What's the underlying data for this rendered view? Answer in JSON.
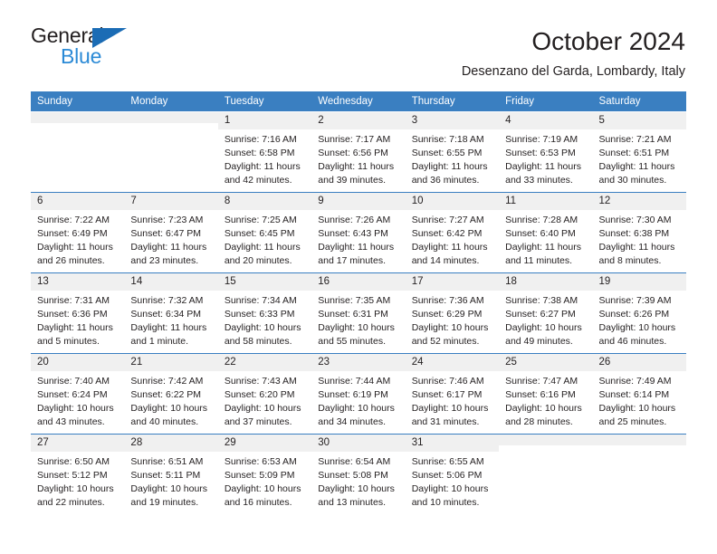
{
  "brand": {
    "name_part1": "General",
    "name_part2": "Blue",
    "accent_dark": "#1b6cb5",
    "accent_light": "#2b8ad6"
  },
  "header": {
    "title": "October 2024",
    "subtitle": "Desenzano del Garda, Lombardy, Italy"
  },
  "theme": {
    "header_blue": "#3a7fc1",
    "daynum_gray": "#f0f0f0",
    "text": "#231f20"
  },
  "weekday_headers": [
    "Sunday",
    "Monday",
    "Tuesday",
    "Wednesday",
    "Thursday",
    "Friday",
    "Saturday"
  ],
  "weeks": [
    [
      {
        "day": "",
        "sunrise": "",
        "sunset": "",
        "daylight": ""
      },
      {
        "day": "",
        "sunrise": "",
        "sunset": "",
        "daylight": ""
      },
      {
        "day": "1",
        "sunrise": "Sunrise: 7:16 AM",
        "sunset": "Sunset: 6:58 PM",
        "daylight": "Daylight: 11 hours and 42 minutes."
      },
      {
        "day": "2",
        "sunrise": "Sunrise: 7:17 AM",
        "sunset": "Sunset: 6:56 PM",
        "daylight": "Daylight: 11 hours and 39 minutes."
      },
      {
        "day": "3",
        "sunrise": "Sunrise: 7:18 AM",
        "sunset": "Sunset: 6:55 PM",
        "daylight": "Daylight: 11 hours and 36 minutes."
      },
      {
        "day": "4",
        "sunrise": "Sunrise: 7:19 AM",
        "sunset": "Sunset: 6:53 PM",
        "daylight": "Daylight: 11 hours and 33 minutes."
      },
      {
        "day": "5",
        "sunrise": "Sunrise: 7:21 AM",
        "sunset": "Sunset: 6:51 PM",
        "daylight": "Daylight: 11 hours and 30 minutes."
      }
    ],
    [
      {
        "day": "6",
        "sunrise": "Sunrise: 7:22 AM",
        "sunset": "Sunset: 6:49 PM",
        "daylight": "Daylight: 11 hours and 26 minutes."
      },
      {
        "day": "7",
        "sunrise": "Sunrise: 7:23 AM",
        "sunset": "Sunset: 6:47 PM",
        "daylight": "Daylight: 11 hours and 23 minutes."
      },
      {
        "day": "8",
        "sunrise": "Sunrise: 7:25 AM",
        "sunset": "Sunset: 6:45 PM",
        "daylight": "Daylight: 11 hours and 20 minutes."
      },
      {
        "day": "9",
        "sunrise": "Sunrise: 7:26 AM",
        "sunset": "Sunset: 6:43 PM",
        "daylight": "Daylight: 11 hours and 17 minutes."
      },
      {
        "day": "10",
        "sunrise": "Sunrise: 7:27 AM",
        "sunset": "Sunset: 6:42 PM",
        "daylight": "Daylight: 11 hours and 14 minutes."
      },
      {
        "day": "11",
        "sunrise": "Sunrise: 7:28 AM",
        "sunset": "Sunset: 6:40 PM",
        "daylight": "Daylight: 11 hours and 11 minutes."
      },
      {
        "day": "12",
        "sunrise": "Sunrise: 7:30 AM",
        "sunset": "Sunset: 6:38 PM",
        "daylight": "Daylight: 11 hours and 8 minutes."
      }
    ],
    [
      {
        "day": "13",
        "sunrise": "Sunrise: 7:31 AM",
        "sunset": "Sunset: 6:36 PM",
        "daylight": "Daylight: 11 hours and 5 minutes."
      },
      {
        "day": "14",
        "sunrise": "Sunrise: 7:32 AM",
        "sunset": "Sunset: 6:34 PM",
        "daylight": "Daylight: 11 hours and 1 minute."
      },
      {
        "day": "15",
        "sunrise": "Sunrise: 7:34 AM",
        "sunset": "Sunset: 6:33 PM",
        "daylight": "Daylight: 10 hours and 58 minutes."
      },
      {
        "day": "16",
        "sunrise": "Sunrise: 7:35 AM",
        "sunset": "Sunset: 6:31 PM",
        "daylight": "Daylight: 10 hours and 55 minutes."
      },
      {
        "day": "17",
        "sunrise": "Sunrise: 7:36 AM",
        "sunset": "Sunset: 6:29 PM",
        "daylight": "Daylight: 10 hours and 52 minutes."
      },
      {
        "day": "18",
        "sunrise": "Sunrise: 7:38 AM",
        "sunset": "Sunset: 6:27 PM",
        "daylight": "Daylight: 10 hours and 49 minutes."
      },
      {
        "day": "19",
        "sunrise": "Sunrise: 7:39 AM",
        "sunset": "Sunset: 6:26 PM",
        "daylight": "Daylight: 10 hours and 46 minutes."
      }
    ],
    [
      {
        "day": "20",
        "sunrise": "Sunrise: 7:40 AM",
        "sunset": "Sunset: 6:24 PM",
        "daylight": "Daylight: 10 hours and 43 minutes."
      },
      {
        "day": "21",
        "sunrise": "Sunrise: 7:42 AM",
        "sunset": "Sunset: 6:22 PM",
        "daylight": "Daylight: 10 hours and 40 minutes."
      },
      {
        "day": "22",
        "sunrise": "Sunrise: 7:43 AM",
        "sunset": "Sunset: 6:20 PM",
        "daylight": "Daylight: 10 hours and 37 minutes."
      },
      {
        "day": "23",
        "sunrise": "Sunrise: 7:44 AM",
        "sunset": "Sunset: 6:19 PM",
        "daylight": "Daylight: 10 hours and 34 minutes."
      },
      {
        "day": "24",
        "sunrise": "Sunrise: 7:46 AM",
        "sunset": "Sunset: 6:17 PM",
        "daylight": "Daylight: 10 hours and 31 minutes."
      },
      {
        "day": "25",
        "sunrise": "Sunrise: 7:47 AM",
        "sunset": "Sunset: 6:16 PM",
        "daylight": "Daylight: 10 hours and 28 minutes."
      },
      {
        "day": "26",
        "sunrise": "Sunrise: 7:49 AM",
        "sunset": "Sunset: 6:14 PM",
        "daylight": "Daylight: 10 hours and 25 minutes."
      }
    ],
    [
      {
        "day": "27",
        "sunrise": "Sunrise: 6:50 AM",
        "sunset": "Sunset: 5:12 PM",
        "daylight": "Daylight: 10 hours and 22 minutes."
      },
      {
        "day": "28",
        "sunrise": "Sunrise: 6:51 AM",
        "sunset": "Sunset: 5:11 PM",
        "daylight": "Daylight: 10 hours and 19 minutes."
      },
      {
        "day": "29",
        "sunrise": "Sunrise: 6:53 AM",
        "sunset": "Sunset: 5:09 PM",
        "daylight": "Daylight: 10 hours and 16 minutes."
      },
      {
        "day": "30",
        "sunrise": "Sunrise: 6:54 AM",
        "sunset": "Sunset: 5:08 PM",
        "daylight": "Daylight: 10 hours and 13 minutes."
      },
      {
        "day": "31",
        "sunrise": "Sunrise: 6:55 AM",
        "sunset": "Sunset: 5:06 PM",
        "daylight": "Daylight: 10 hours and 10 minutes."
      },
      {
        "day": "",
        "sunrise": "",
        "sunset": "",
        "daylight": ""
      },
      {
        "day": "",
        "sunrise": "",
        "sunset": "",
        "daylight": ""
      }
    ]
  ]
}
